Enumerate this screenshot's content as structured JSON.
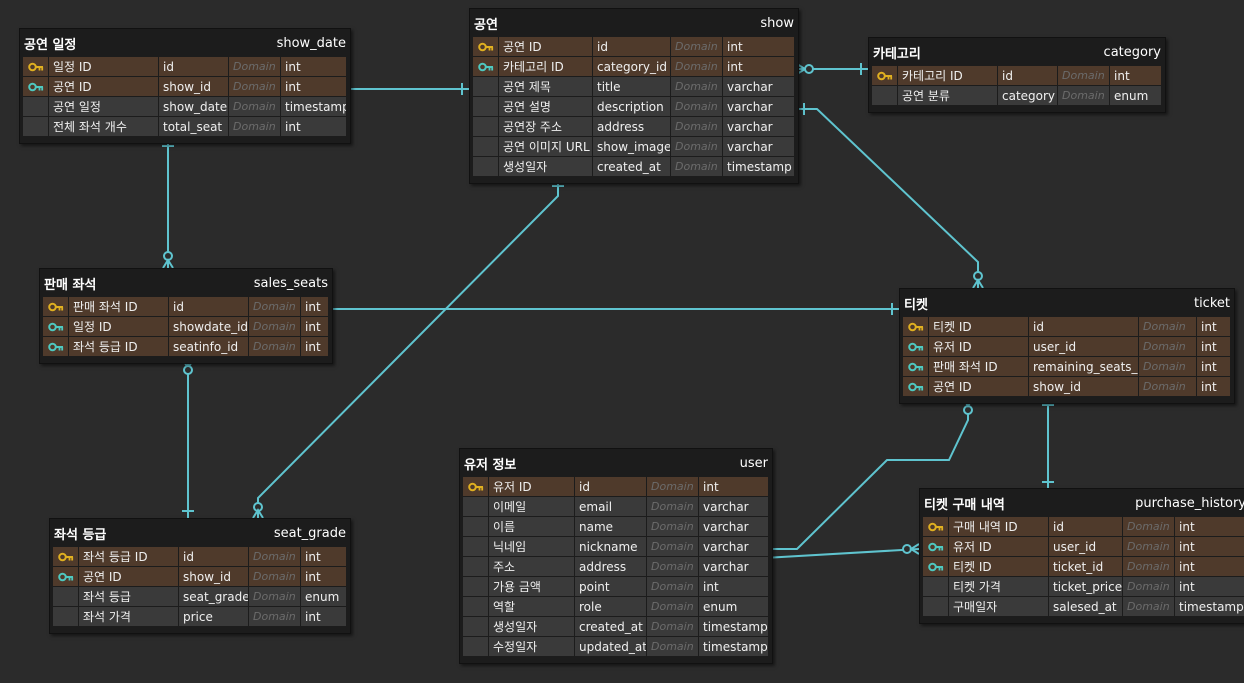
{
  "tables": {
    "show_date": {
      "title": "공연 일정",
      "name": "show_date",
      "rows": [
        {
          "label": "일정 ID",
          "field": "id",
          "domain": "Domain",
          "type": "int",
          "key": "pk"
        },
        {
          "label": "공연 ID",
          "field": "show_id",
          "domain": "Domain",
          "type": "int",
          "key": "fk"
        },
        {
          "label": "공연 일정",
          "field": "show_date",
          "domain": "Domain",
          "type": "timestamp",
          "key": ""
        },
        {
          "label": "전체 좌석 개수",
          "field": "total_seat",
          "domain": "Domain",
          "type": "int",
          "key": ""
        }
      ]
    },
    "show": {
      "title": "공연",
      "name": "show",
      "rows": [
        {
          "label": "공연 ID",
          "field": "id",
          "domain": "Domain",
          "type": "int",
          "key": "pk"
        },
        {
          "label": "카테고리 ID",
          "field": "category_id",
          "domain": "Domain",
          "type": "int",
          "key": "fk"
        },
        {
          "label": "공연 제목",
          "field": "title",
          "domain": "Domain",
          "type": "varchar",
          "key": ""
        },
        {
          "label": "공연 설명",
          "field": "description",
          "domain": "Domain",
          "type": "varchar",
          "key": ""
        },
        {
          "label": "공연장 주소",
          "field": "address",
          "domain": "Domain",
          "type": "varchar",
          "key": ""
        },
        {
          "label": "공연 이미지 URL",
          "field": "show_image",
          "domain": "Domain",
          "type": "varchar",
          "key": ""
        },
        {
          "label": "생성일자",
          "field": "created_at",
          "domain": "Domain",
          "type": "timestamp",
          "key": ""
        }
      ]
    },
    "category": {
      "title": "카테고리",
      "name": "category",
      "rows": [
        {
          "label": "카테고리 ID",
          "field": "id",
          "domain": "Domain",
          "type": "int",
          "key": "pk"
        },
        {
          "label": "공연 분류",
          "field": "category",
          "domain": "Domain",
          "type": "enum",
          "key": ""
        }
      ]
    },
    "sales_seats": {
      "title": "판매 좌석",
      "name": "sales_seats",
      "rows": [
        {
          "label": "판매 좌석 ID",
          "field": "id",
          "domain": "Domain",
          "type": "int",
          "key": "pk"
        },
        {
          "label": "일정 ID",
          "field": "showdate_id",
          "domain": "Domain",
          "type": "int",
          "key": "fk"
        },
        {
          "label": "좌석 등급 ID",
          "field": "seatinfo_id",
          "domain": "Domain",
          "type": "int",
          "key": "fk"
        }
      ]
    },
    "ticket": {
      "title": "티켓",
      "name": "ticket",
      "rows": [
        {
          "label": "티켓 ID",
          "field": "id",
          "domain": "Domain",
          "type": "int",
          "key": "pk"
        },
        {
          "label": "유저 ID",
          "field": "user_id",
          "domain": "Domain",
          "type": "int",
          "key": "fk"
        },
        {
          "label": "판매 좌석 ID",
          "field": "remaining_seats_id",
          "domain": "Domain",
          "type": "int",
          "key": "fk"
        },
        {
          "label": "공연 ID",
          "field": "show_id",
          "domain": "Domain",
          "type": "int",
          "key": "fk"
        }
      ]
    },
    "user": {
      "title": "유저 정보",
      "name": "user",
      "rows": [
        {
          "label": "유저 ID",
          "field": "id",
          "domain": "Domain",
          "type": "int",
          "key": "pk"
        },
        {
          "label": "이메일",
          "field": "email",
          "domain": "Domain",
          "type": "varchar",
          "key": ""
        },
        {
          "label": "이름",
          "field": "name",
          "domain": "Domain",
          "type": "varchar",
          "key": ""
        },
        {
          "label": "닉네임",
          "field": "nickname",
          "domain": "Domain",
          "type": "varchar",
          "key": ""
        },
        {
          "label": "주소",
          "field": "address",
          "domain": "Domain",
          "type": "varchar",
          "key": ""
        },
        {
          "label": "가용 금액",
          "field": "point",
          "domain": "Domain",
          "type": "int",
          "key": ""
        },
        {
          "label": "역할",
          "field": "role",
          "domain": "Domain",
          "type": "enum",
          "key": ""
        },
        {
          "label": "생성일자",
          "field": "created_at",
          "domain": "Domain",
          "type": "timestamp",
          "key": ""
        },
        {
          "label": "수정일자",
          "field": "updated_at",
          "domain": "Domain",
          "type": "timestamp",
          "key": ""
        }
      ]
    },
    "seat_grade": {
      "title": "좌석 등급",
      "name": "seat_grade",
      "rows": [
        {
          "label": "좌석 등급 ID",
          "field": "id",
          "domain": "Domain",
          "type": "int",
          "key": "pk"
        },
        {
          "label": "공연 ID",
          "field": "show_id",
          "domain": "Domain",
          "type": "int",
          "key": "fk"
        },
        {
          "label": "좌석 등급",
          "field": "seat_grade",
          "domain": "Domain",
          "type": "enum",
          "key": ""
        },
        {
          "label": "좌석 가격",
          "field": "price",
          "domain": "Domain",
          "type": "int",
          "key": ""
        }
      ]
    },
    "purchase_history": {
      "title": "티켓 구매 내역",
      "name": "purchase_history",
      "rows": [
        {
          "label": "구매 내역 ID",
          "field": "id",
          "domain": "Domain",
          "type": "int",
          "key": "pk"
        },
        {
          "label": "유저 ID",
          "field": "user_id",
          "domain": "Domain",
          "type": "int",
          "key": "fk"
        },
        {
          "label": "티켓 ID",
          "field": "ticket_id",
          "domain": "Domain",
          "type": "int",
          "key": "fk"
        },
        {
          "label": "티켓 가격",
          "field": "ticket_price",
          "domain": "Domain",
          "type": "int",
          "key": ""
        },
        {
          "label": "구매일자",
          "field": "salesed_at",
          "domain": "Domain",
          "type": "timestamp",
          "key": ""
        }
      ]
    }
  },
  "colors": {
    "canvas": "#2b2b2b",
    "edge": "#5fc4cf",
    "pk_key": "#e0b020",
    "fk_key": "#4fc9c0",
    "key_row": "#4f3a2b",
    "plain_row": "#3a3a3a"
  },
  "icons": {
    "pk": "key-icon",
    "fk": "foreign-key-icon"
  }
}
